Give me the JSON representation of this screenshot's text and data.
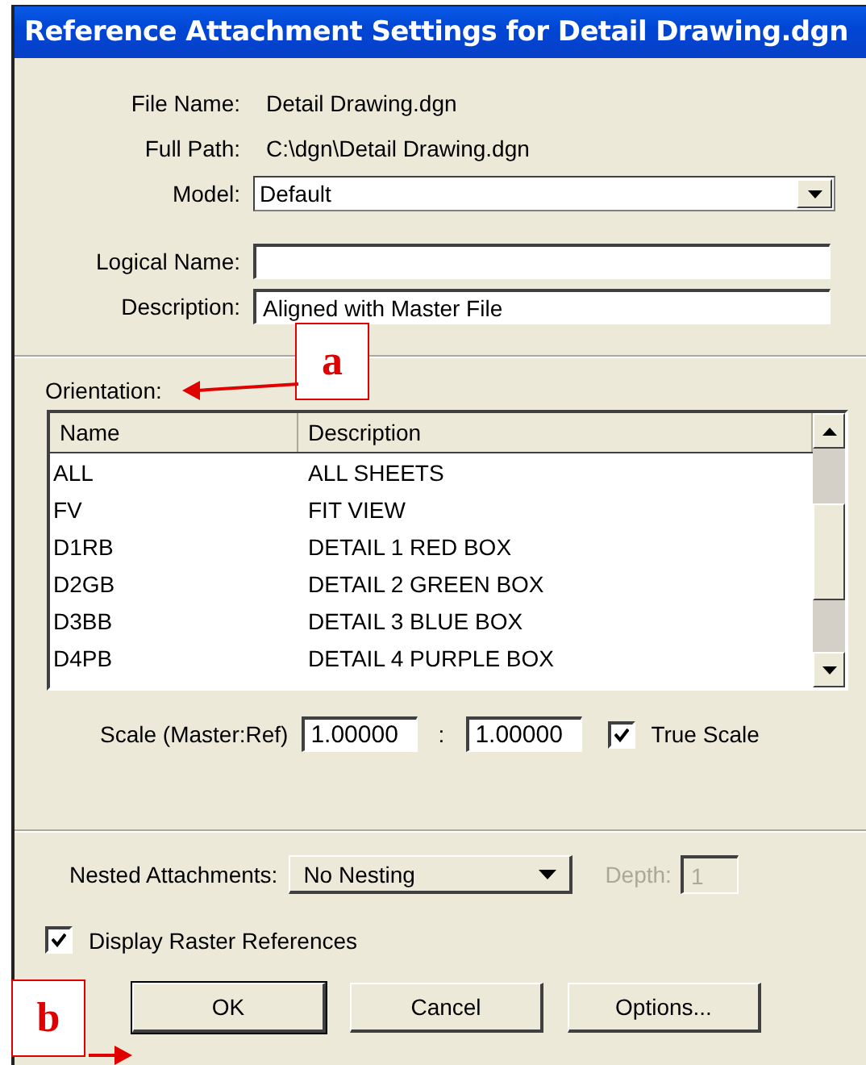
{
  "window": {
    "title": "Reference Attachment Settings for Detail Drawing.dgn"
  },
  "file_fields": [
    {
      "label": "File Name:",
      "kind": "text",
      "value": "Detail Drawing.dgn"
    },
    {
      "label": "Full Path:",
      "kind": "text",
      "value": "C:\\dgn\\Detail Drawing.dgn"
    },
    {
      "label": "Model:",
      "kind": "dropdown",
      "value": "Default"
    }
  ],
  "name_fields": [
    {
      "label": "Logical Name:",
      "kind": "input"
    },
    {
      "label": "Description:",
      "kind": "input",
      "value": "Aligned with Master File"
    }
  ],
  "orientation": {
    "label": "Orientation:",
    "columns": [
      "Name",
      "Description"
    ],
    "rows": [
      {
        "name": "ALL",
        "description": "ALL SHEETS"
      },
      {
        "name": "FV",
        "description": "FIT VIEW"
      },
      {
        "name": "D1RB",
        "description": "DETAIL 1 RED BOX"
      },
      {
        "name": "D2GB",
        "description": "DETAIL 2 GREEN BOX"
      },
      {
        "name": "D3BB",
        "description": "DETAIL 3 BLUE BOX"
      },
      {
        "name": "D4PB",
        "description": "DETAIL 4 PURPLE BOX"
      }
    ]
  },
  "scale": {
    "label": "Scale (Master:Ref)",
    "master": "1.00000",
    "separator": ":",
    "ref": "1.00000",
    "true_scale": {
      "label": "True Scale",
      "checked": true
    }
  },
  "nesting": {
    "label": "Nested Attachments:",
    "value": "No Nesting",
    "depth": {
      "label": "Depth:",
      "value": "1",
      "disabled": true
    }
  },
  "display_raster": {
    "label": "Display Raster References",
    "checked": true
  },
  "buttons": [
    {
      "label": "OK",
      "default": true
    },
    {
      "label": "Cancel",
      "default": false
    },
    {
      "label": "Options...",
      "default": false
    }
  ],
  "annotations": [
    {
      "label": "a"
    },
    {
      "label": "b"
    }
  ]
}
